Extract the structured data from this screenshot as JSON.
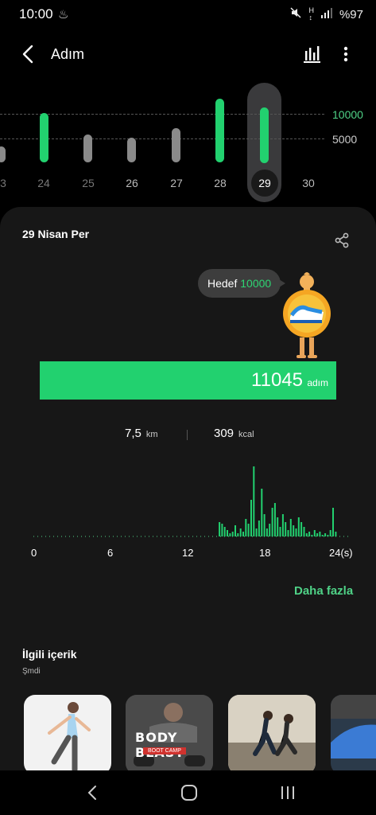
{
  "status_bar": {
    "time": "10:00",
    "battery": "%97",
    "icons": [
      "mute-icon",
      "signal-h-icon",
      "cell-signal-icon"
    ]
  },
  "header": {
    "title": "Adım",
    "icons": [
      "back-arrow-icon",
      "bar-chart-icon",
      "more-vert-icon"
    ]
  },
  "week_chart": {
    "grid_labels": [
      "10000",
      "5000"
    ],
    "days": [
      "3",
      "24",
      "25",
      "26",
      "27",
      "28",
      "29",
      "30"
    ],
    "selected_day": "29",
    "colors": {
      "goal_met": "#22d16f",
      "below_goal": "#8a8a8a",
      "grid_label_high": "#4fd287",
      "grid_label_low": "#cccccc"
    }
  },
  "card": {
    "date": "29 Nisan Per",
    "goal_label": "Hedef",
    "goal_value": "10000",
    "steps": "11045",
    "steps_unit": "adım",
    "distance": "7,5",
    "distance_unit": "km",
    "calories": "309",
    "calories_unit": "kcal",
    "hour_axis": [
      "0",
      "6",
      "12",
      "18",
      "24(s)"
    ],
    "more_link": "Daha fazla"
  },
  "related": {
    "title": "İlgili içerik",
    "subtitle": "Şmdi",
    "items": [
      {
        "name": "stretching-woman-thumbnail"
      },
      {
        "name": "body-blast-thumbnail",
        "text": "BODY BLAST",
        "subtext": "BOOT CAMP"
      },
      {
        "name": "running-couple-thumbnail"
      },
      {
        "name": "blue-workout-thumbnail"
      }
    ]
  },
  "nav_bar": {
    "icons": [
      "recent-apps-icon",
      "home-icon",
      "back-nav-icon"
    ]
  }
}
